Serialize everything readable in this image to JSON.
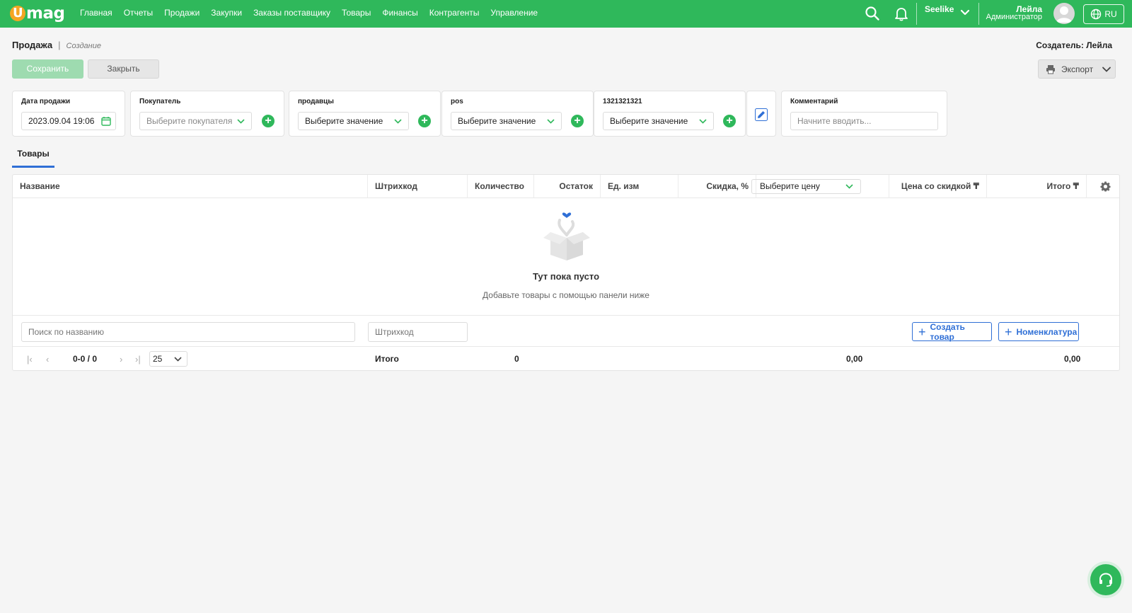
{
  "app": {
    "logo_u": "U",
    "logo_rest": "mag"
  },
  "nav": [
    "Главная",
    "Отчеты",
    "Продажи",
    "Закупки",
    "Заказы поставщику",
    "Товары",
    "Финансы",
    "Контрагенты",
    "Управление"
  ],
  "header": {
    "store": "Seelike",
    "user_name": "Лейла",
    "user_role": "Администратор",
    "lang": "RU"
  },
  "page": {
    "title": "Продажа",
    "subtitle": "Создание",
    "creator": "Создатель: Лейла",
    "save_label": "Сохранить",
    "close_label": "Закрыть",
    "export_label": "Экспорт"
  },
  "fields": {
    "date": {
      "label": "Дата продажи",
      "value": "2023.09.04 19:06"
    },
    "buyer": {
      "label": "Покупатель",
      "placeholder": "Выберите покупателя"
    },
    "sellers": {
      "label": "продавцы",
      "value": "Выберите значение"
    },
    "pos": {
      "label": "pos",
      "value": "Выберите значение"
    },
    "custom": {
      "label": "1321321321",
      "value": "Выберите значение"
    },
    "comment": {
      "label": "Комментарий",
      "placeholder": "Начните вводить..."
    }
  },
  "tabs": {
    "goods": "Товары"
  },
  "table": {
    "columns": {
      "name": "Название",
      "barcode": "Штрихкод",
      "qty": "Количество",
      "stock": "Остаток",
      "unit": "Ед. изм",
      "discount": "Скидка, %",
      "price_select": "Выберите цену",
      "discount_price": "Цена со скидкой ₸",
      "total": "Итого ₸"
    },
    "empty_title": "Тут пока пусто",
    "empty_sub": "Добавьте товары с помощью панели ниже",
    "search_placeholder": "Поиск по названию",
    "barcode_placeholder": "Штрихкод",
    "create_label": "Создать товар",
    "nomenclature_label": "Номенклатура",
    "pagination": {
      "info": "0-0 / 0",
      "page_size": "25"
    },
    "footer": {
      "total_label": "Итого",
      "qty_total": "0",
      "discount_price_total": "0,00",
      "grand_total": "0,00"
    }
  },
  "colors": {
    "brand": "#2fb85b",
    "accent_blue": "#2f6fd6",
    "logo_orange": "#f5a623"
  }
}
